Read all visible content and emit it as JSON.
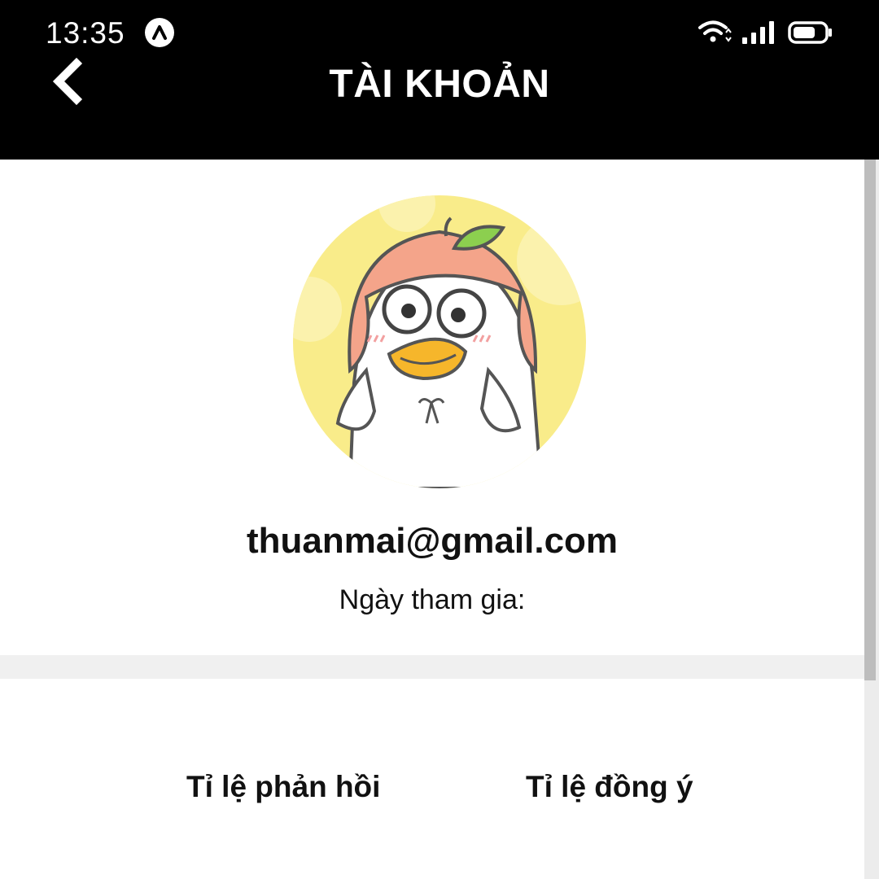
{
  "status_bar": {
    "time": "13:35",
    "icons": [
      "app-a-icon",
      "wifi-icon",
      "signal-icon",
      "battery-icon"
    ]
  },
  "header": {
    "title": "TÀI KHOẢN",
    "back_icon": "chevron-left-icon"
  },
  "profile": {
    "email": "thuanmai@gmail.com",
    "join_date_label": "Ngày tham gia:",
    "avatar": "duck-peach-hat-avatar"
  },
  "stats": {
    "response_rate_label": "Tỉ lệ phản hồi",
    "agreement_rate_label": "Tỉ lệ đồng ý"
  },
  "colors": {
    "header_bg": "#000000",
    "header_text": "#ffffff",
    "avatar_bg": "#f9ec8a",
    "divider": "#f0f0f0"
  }
}
